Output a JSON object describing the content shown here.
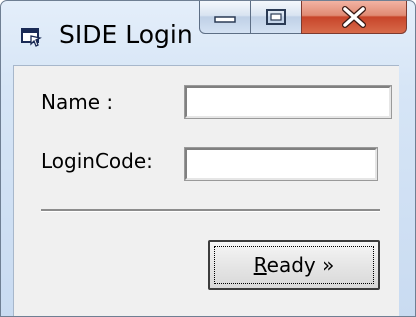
{
  "window": {
    "title": "SIDE Login",
    "app_icon": "window-app-icon",
    "caption": {
      "minimize_icon": "minimize-icon",
      "maximize_icon": "maximize-icon",
      "close_icon": "close-icon"
    },
    "colors": {
      "frame": "#d6e5f6",
      "client_background": "#f0f0f0",
      "close_button": "#c7452a"
    }
  },
  "form": {
    "name_label": "Name  :",
    "name_value": "",
    "logincode_label": "LoginCode:",
    "logincode_value": "",
    "ready_button": {
      "mnemonic": "R",
      "label_rest": "eady »"
    }
  }
}
